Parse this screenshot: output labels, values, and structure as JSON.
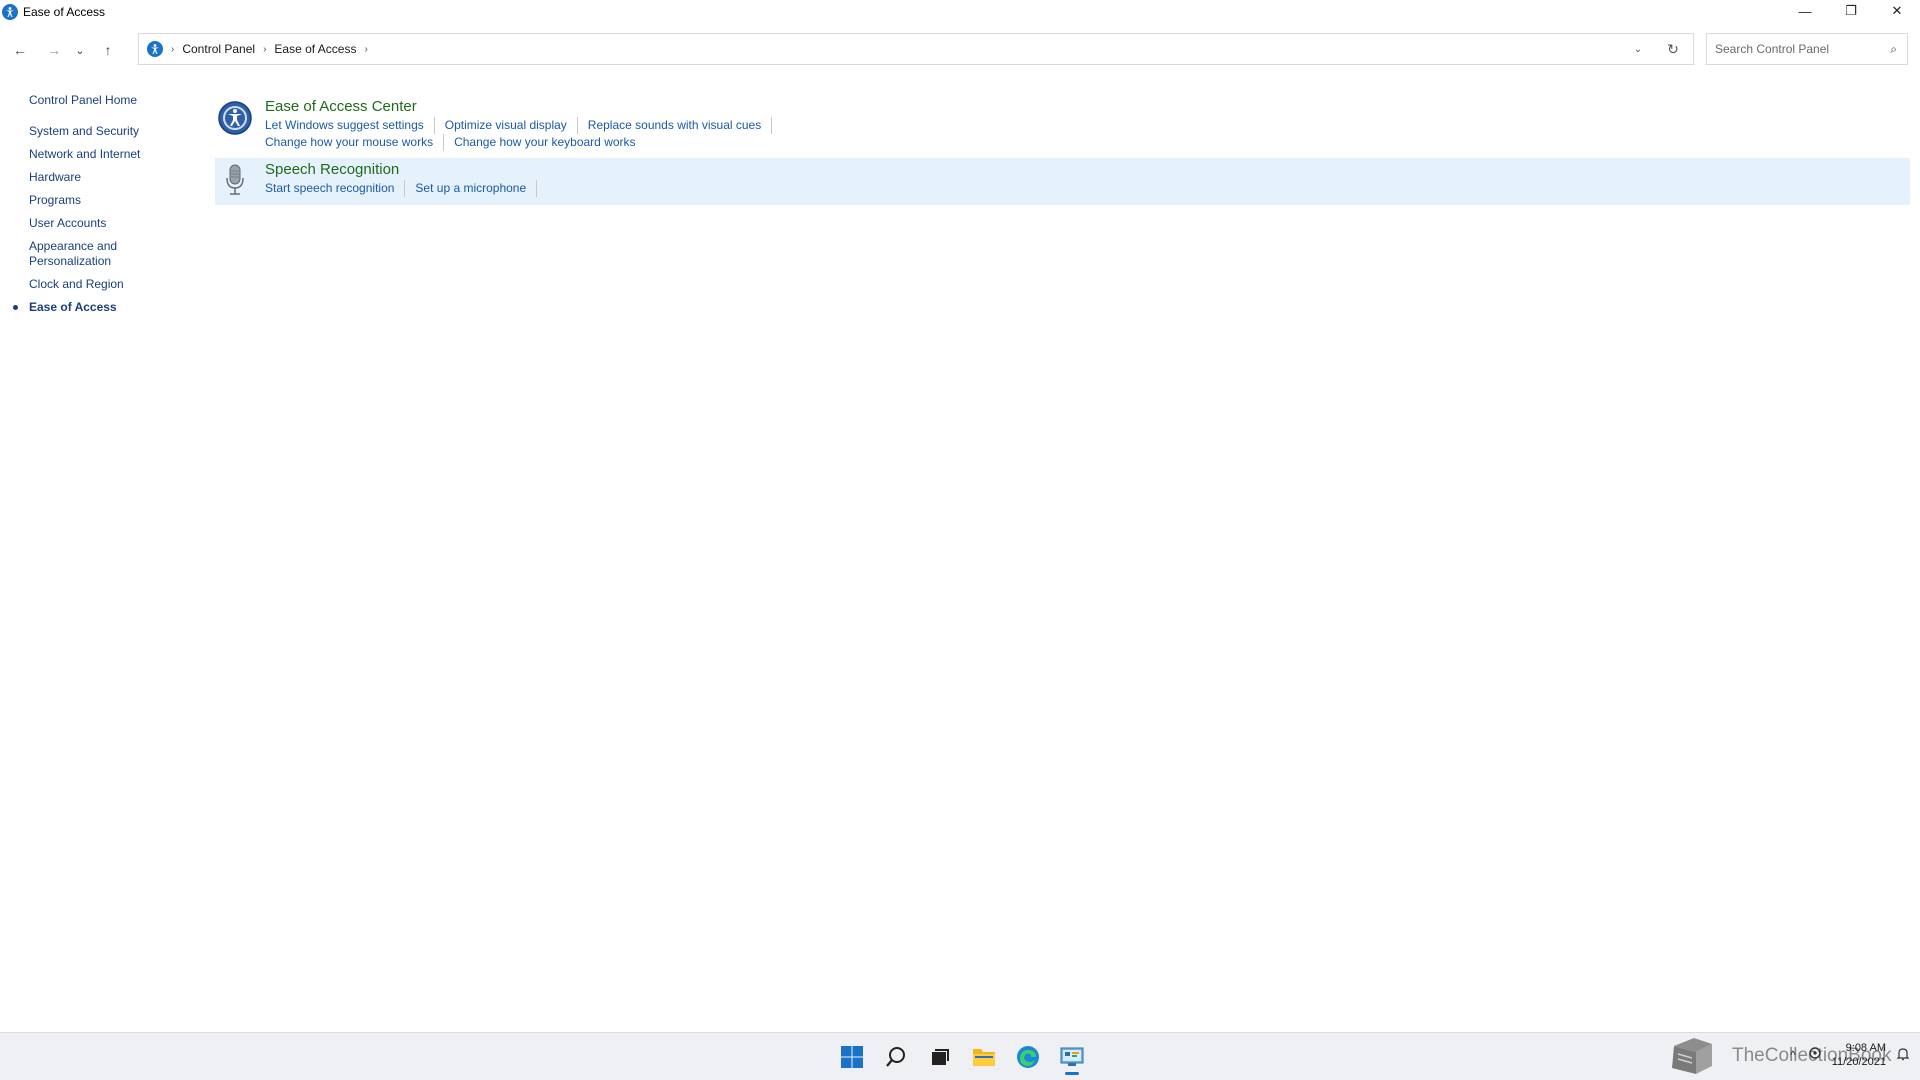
{
  "window": {
    "title": "Ease of Access",
    "controls": {
      "minimize": "—",
      "restore": "❐",
      "close": "✕"
    }
  },
  "nav": {
    "back": "←",
    "forward": "→",
    "recent": "⌄",
    "up": "↑"
  },
  "address": {
    "crumbs": [
      "Control Panel",
      "Ease of Access"
    ],
    "separator": "›",
    "dropdown": "⌄",
    "refresh": "↻"
  },
  "search": {
    "placeholder": "Search Control Panel",
    "icon": "⌕"
  },
  "sidebar": {
    "home": "Control Panel Home",
    "items": [
      {
        "label": "System and Security"
      },
      {
        "label": "Network and Internet"
      },
      {
        "label": "Hardware"
      },
      {
        "label": "Programs"
      },
      {
        "label": "User Accounts"
      },
      {
        "label": "Appearance and Personalization"
      },
      {
        "label": "Clock and Region"
      },
      {
        "label": "Ease of Access"
      }
    ]
  },
  "categories": [
    {
      "title": "Ease of Access Center",
      "links": [
        [
          "Let Windows suggest settings",
          "Optimize visual display",
          "Replace sounds with visual cues"
        ],
        [
          "Change how your mouse works",
          "Change how your keyboard works"
        ]
      ]
    },
    {
      "title": "Speech Recognition",
      "links": [
        [
          "Start speech recognition",
          "Set up a microphone"
        ]
      ]
    }
  ],
  "taskbar": {
    "watermark": "TheCollectionBook",
    "clock": {
      "time": "9:08 AM",
      "date": "11/20/2021"
    },
    "tray_chevron": "^"
  },
  "colors": {
    "accent": "#1a73c9",
    "category_title": "#1f6b1c",
    "link": "#1a5aa8",
    "hover_bg": "#e5f1fb"
  }
}
